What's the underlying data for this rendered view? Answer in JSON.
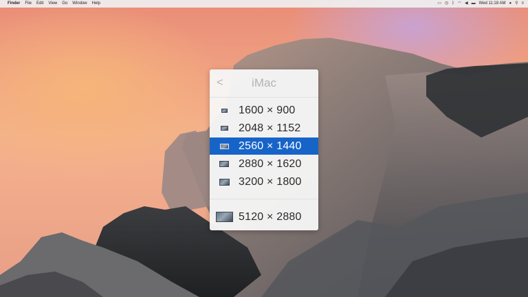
{
  "menubar": {
    "apple": "",
    "app_name": "Finder",
    "menus": [
      "File",
      "Edit",
      "View",
      "Go",
      "Window",
      "Help"
    ],
    "clock": "Wed 11:18 AM",
    "status_icons": [
      "display-icon",
      "time-machine-icon",
      "bluetooth-icon",
      "wifi-icon",
      "volume-icon",
      "battery-icon",
      "user-icon",
      "spotlight-icon",
      "notification-center-icon"
    ]
  },
  "panel": {
    "back_label": "<",
    "title": "iMac",
    "resolutions": [
      {
        "label": "1600 × 900",
        "selected": false
      },
      {
        "label": "2048 × 1152",
        "selected": false
      },
      {
        "label": "2560 × 1440",
        "selected": true
      },
      {
        "label": "2880 × 1620",
        "selected": false
      },
      {
        "label": "3200 × 1800",
        "selected": false
      }
    ],
    "native_resolution": {
      "label": "5120 × 2880",
      "selected": false
    }
  },
  "colors": {
    "selection": "#1764c9",
    "panel_background": "#f6f6f6",
    "title_text": "#b3b3b3"
  }
}
